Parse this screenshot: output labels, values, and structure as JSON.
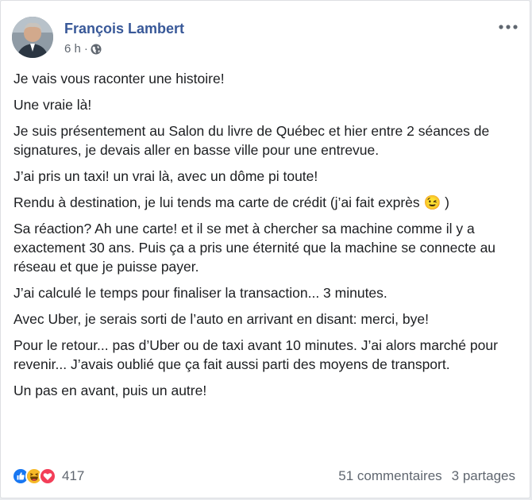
{
  "post": {
    "author": "François Lambert",
    "time": "6 h",
    "separator": "·",
    "paragraphs": [
      "Je vais vous raconter une histoire!",
      "Une vraie là!",
      "Je suis présentement au Salon du livre de Québec et hier entre 2 séances de signatures, je devais aller en basse ville pour une entrevue.",
      "J’ai pris un taxi! un vrai là, avec un dôme pi toute!",
      "Rendu à destination, je lui tends ma carte de crédit (j’ai fait exprès 😉 )",
      "Sa réaction? Ah une carte! et il se met à chercher sa machine comme il y a exactement 30 ans. Puis ça a pris une éternité que la machine se connecte au réseau et que je puisse payer.",
      "J’ai calculé le temps pour finaliser la transaction... 3 minutes.",
      "Avec Uber, je serais sorti de l’auto en arrivant en disant: merci, bye!",
      "Pour le retour... pas d’Uber ou de taxi avant 10 minutes. J’ai alors marché pour revenir... J’avais oublié que ça fait aussi parti des moyens de transport.",
      "Un pas en avant, puis un autre!"
    ],
    "reactions": {
      "icons": [
        "like-icon",
        "haha-icon",
        "love-icon"
      ],
      "count": "417"
    },
    "comments": "51 commentaires",
    "shares": "3 partages"
  },
  "colors": {
    "author": "#385898",
    "text": "#1c1e21",
    "secondary": "#606770",
    "like": "#1877f2",
    "haha": "#f7b928",
    "love": "#f33e58"
  }
}
